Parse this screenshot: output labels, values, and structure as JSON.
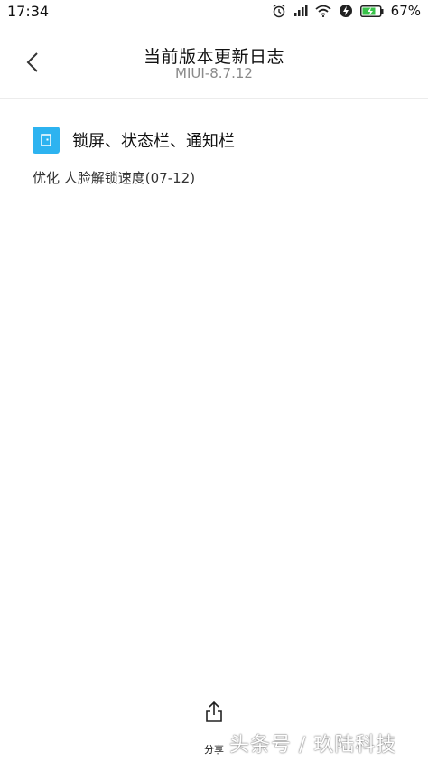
{
  "status_bar": {
    "time": "17:34",
    "battery_percent": "67%",
    "icons": [
      "alarm-icon",
      "signal-icon",
      "wifi-icon",
      "data-icon",
      "battery-charging-icon"
    ]
  },
  "header": {
    "back_icon": "chevron-left-icon",
    "title": "当前版本更新日志",
    "version": "MIUI-8.7.12"
  },
  "changelog": {
    "section_icon": "lockscreen-icon",
    "section_title": "锁屏、状态栏、通知栏",
    "items": [
      "优化 人脸解锁速度(07-12)"
    ]
  },
  "bottom_bar": {
    "share_icon": "share-icon",
    "share_label": "分享",
    "watermark": "头条号 / 玖陆科技"
  },
  "colors": {
    "accent": "#2db3f0",
    "battery_green": "#39c24a",
    "subtitle_gray": "#8a8a8a"
  }
}
